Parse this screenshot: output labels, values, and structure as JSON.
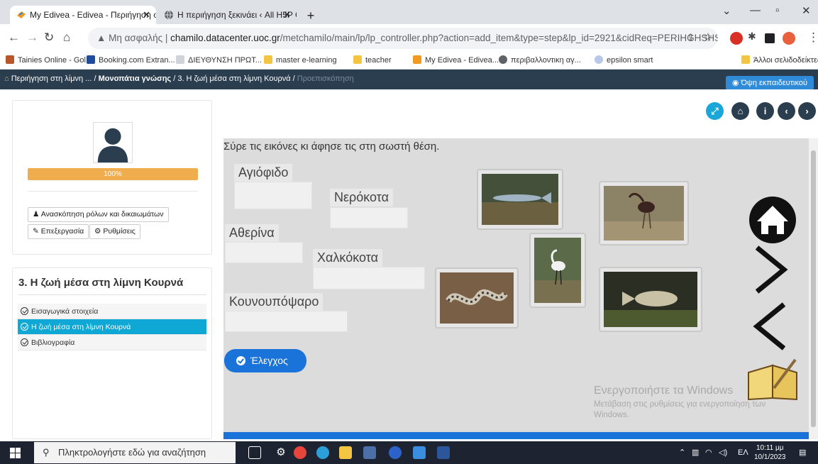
{
  "browser": {
    "tabs": [
      {
        "title": "My Edivea - Edivea - Περιήγηση στ",
        "active": true
      },
      {
        "title": "Η περιήγηση ξεκινάει ‹ All H5P C",
        "active": false
      }
    ],
    "url_warning": "Μη ασφαλής",
    "url_host": "chamilo.datacenter.uoc.gr",
    "url_path": "/metchamilo/main/lp/lp_controller.php?action=add_item&type=step&lp_id=2921&cidReq=PERIHGHSHSTHLI...",
    "bookmarks": [
      "Tainies Online - Gol...",
      "Booking.com Extran...",
      "ΔΙΕΥΘΥΝΣΗ ΠΡΩΤ...",
      "master e-learning",
      "teacher",
      "My Edivea - Edivea...",
      "περιβαλλοντικη αγ...",
      "epsilon smart"
    ],
    "other_bookmarks": "Άλλοι σελιδοδείκτες"
  },
  "breadcrumb": {
    "items": [
      "Περιήγηση στη λίμνη ...",
      "Μονοπάτια γνώσης",
      "3. Η ζωή μέσα στη λίμνη Κουρνά"
    ],
    "last": "Προεπισκόπηση"
  },
  "teacher_view": "Όψη εκπαιδευτικού",
  "profile": {
    "progress_label": "100%",
    "progress_value": 100,
    "review_button": "Ανασκόπηση ρόλων και δικαιωμάτων",
    "edit_button": "Επεξεργασία",
    "settings_button": "Ρυθμίσεις"
  },
  "toc": {
    "title": "3. Η ζωή μέσα στη λίμνη Κουρνά",
    "items": [
      {
        "label": "Εισαγωγικά στοιχεία",
        "active": false
      },
      {
        "label": "Η ζωή μέσα στη λίμνη Κουρνά",
        "active": true
      },
      {
        "label": "Βιβλιογραφία",
        "active": false
      }
    ]
  },
  "h5p": {
    "question": "Σύρε τις εικόνες κι άφησε τις στη σωστή θέση.",
    "dropzones": [
      "Αγιόφιδο",
      "Νερόκοτα",
      "Αθερίνα",
      "Χαλκόκοτα",
      "Κουνουπόψαρο"
    ],
    "images": [
      "fish-image",
      "ibis-image",
      "egret-image",
      "snake-image",
      "mosquitofish-image"
    ],
    "check_button": "Έλεγχος",
    "activate_title": "Ενεργοποιήστε τα Windows",
    "activate_text": "Μετάβαση στις ρυθμίσεις για ενεργοποίηση των Windows."
  },
  "taskbar": {
    "search_placeholder": "Πληκτρολογήστε εδώ για αναζήτηση",
    "lang": "ΕΛ",
    "time": "10:11 μμ",
    "date": "10/1/2023"
  }
}
